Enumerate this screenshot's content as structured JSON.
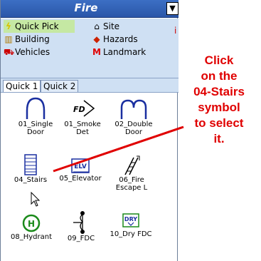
{
  "title": "Fire",
  "dropdown_glyph": "▼",
  "categories": [
    {
      "label": "Quick Pick",
      "icon": "lightning-icon",
      "selected": true
    },
    {
      "label": "Site",
      "icon": "site-icon"
    },
    {
      "label": "Building",
      "icon": "building-icon"
    },
    {
      "label": "Hazards",
      "icon": "hazards-icon"
    },
    {
      "label": "Vehicles",
      "icon": "vehicle-icon"
    },
    {
      "label": "Landmark",
      "icon": "landmark-icon"
    }
  ],
  "tabs": [
    "Quick 1",
    "Quick 2"
  ],
  "symbols": [
    {
      "line1": "01_Single",
      "line2": "Door"
    },
    {
      "line1": "01_Smoke Det",
      "line2": ""
    },
    {
      "line1": "02_Double",
      "line2": "Door"
    },
    {
      "line1": "04_Stairs",
      "line2": ""
    },
    {
      "line1": "05_Elevator",
      "line2": ""
    },
    {
      "line1": "06_Fire",
      "line2": "Escape L"
    },
    {
      "line1": "08_Hydrant",
      "line2": ""
    },
    {
      "line1": "09_FDC",
      "line2": ""
    },
    {
      "line1": "10_Dry FDC",
      "line2": ""
    }
  ],
  "symbol_glyphs": {
    "smoke": "FD",
    "elevator": "ELV",
    "hydrant": "H",
    "dry": "DRY"
  },
  "annotation": {
    "lines": [
      "Click",
      "on the",
      "04-Stairs",
      "symbol",
      "to select",
      "it."
    ]
  },
  "colors": {
    "title_bg": "#2a56a8",
    "annotation": "#e00000",
    "pointer_line": "#e00000",
    "symbol": "#1a2fa0",
    "hydrant": "#1a8a1a"
  }
}
